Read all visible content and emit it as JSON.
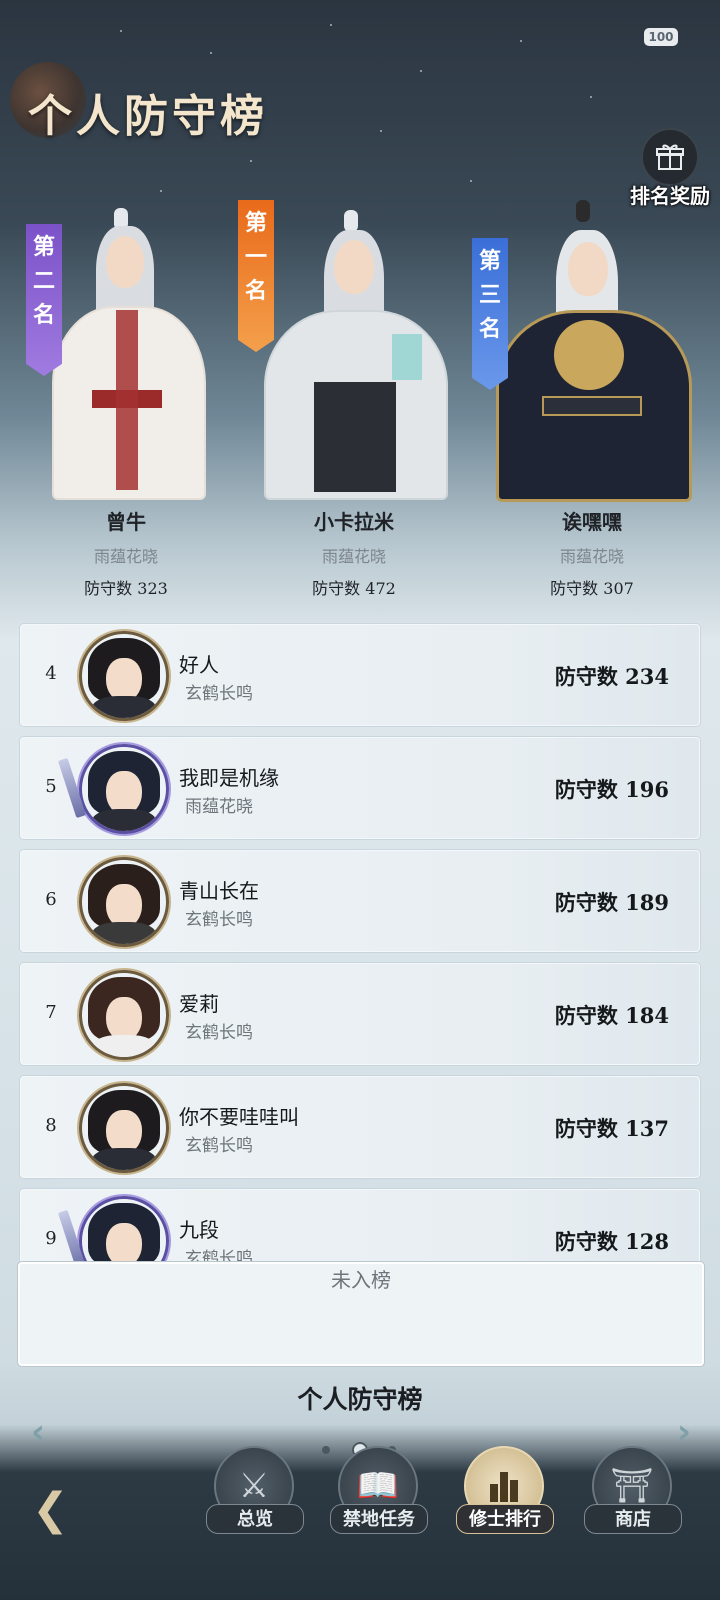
{
  "status": {
    "battery": "100"
  },
  "header": {
    "title": "个人防守榜",
    "reward_label": "排名奖励",
    "reward_icon": "gift-icon"
  },
  "podium": [
    {
      "rank_banner": [
        "第",
        "二",
        "名"
      ],
      "name": "曾牛",
      "guild": "雨蕴花晓",
      "score_label": "防守数",
      "score": "323",
      "banner_color": "#8a5fd6"
    },
    {
      "rank_banner": [
        "第",
        "一",
        "名"
      ],
      "name": "小卡拉米",
      "guild": "雨蕴花晓",
      "score_label": "防守数",
      "score": "472",
      "banner_color": "#ef7c2a"
    },
    {
      "rank_banner": [
        "第",
        "三",
        "名"
      ],
      "name": "诶嘿嘿",
      "guild": "雨蕴花晓",
      "score_label": "防守数",
      "score": "307",
      "banner_color": "#4a80e0"
    }
  ],
  "ranking": [
    {
      "rank": "4",
      "name": "好人",
      "guild": "玄鹤长鸣",
      "score": "防守数 234"
    },
    {
      "rank": "5",
      "name": "我即是机缘",
      "guild": "雨蕴花晓",
      "score": "防守数 196"
    },
    {
      "rank": "6",
      "name": "青山长在",
      "guild": "玄鹤长鸣",
      "score": "防守数 189"
    },
    {
      "rank": "7",
      "name": "爱莉",
      "guild": "玄鹤长鸣",
      "score": "防守数 184"
    },
    {
      "rank": "8",
      "name": "你不要哇哇叫",
      "guild": "玄鹤长鸣",
      "score": "防守数 137"
    },
    {
      "rank": "9",
      "name": "九段",
      "guild": "玄鹤长鸣",
      "score": "防守数 128"
    }
  ],
  "self_rank": "未入榜",
  "switcher": {
    "board_name": "个人防守榜",
    "page_count": 3,
    "active_page": 2
  },
  "nav": [
    {
      "label": "总览",
      "icon": "crossed-swords-icon",
      "active": false
    },
    {
      "label": "禁地任务",
      "icon": "book-icon",
      "active": false
    },
    {
      "label": "修士排行",
      "icon": "ranking-bars-icon",
      "active": true
    },
    {
      "label": "商店",
      "icon": "pavilion-icon",
      "active": false
    }
  ],
  "colors": {
    "accent_gold": "#d9c9a4",
    "text_dark": "#16191c",
    "text_muted": "#6d757b"
  }
}
